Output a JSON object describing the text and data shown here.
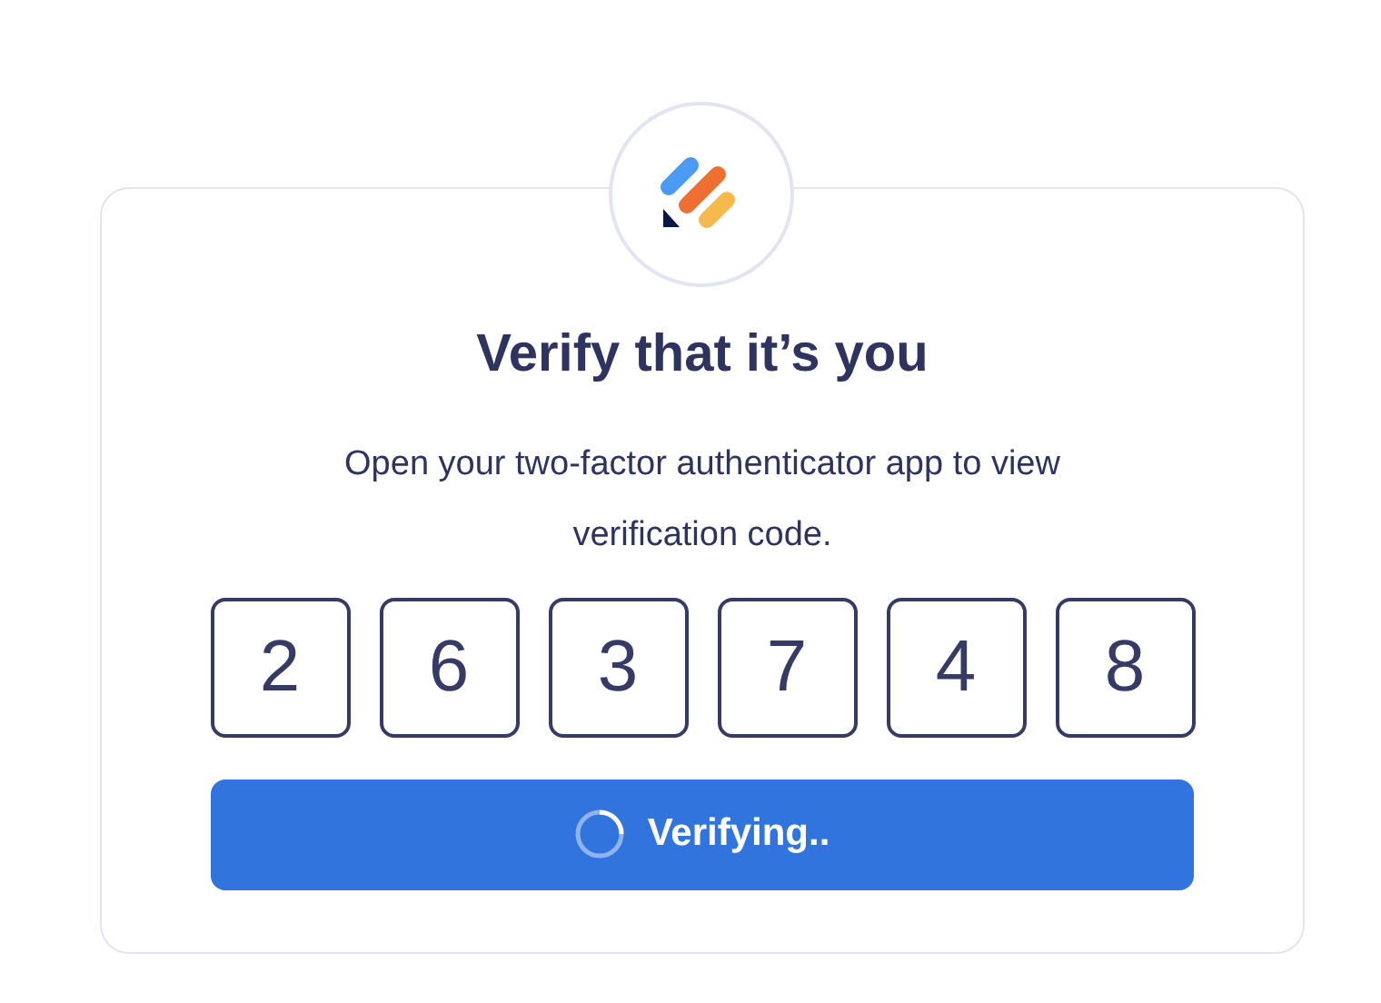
{
  "title": "Verify that it’s you",
  "subtitle": "Open your two-factor authenticator app to view verification code.",
  "code_digits": [
    "2",
    "6",
    "3",
    "7",
    "4",
    "8"
  ],
  "button": {
    "label": "Verifying..",
    "loading": true
  }
}
